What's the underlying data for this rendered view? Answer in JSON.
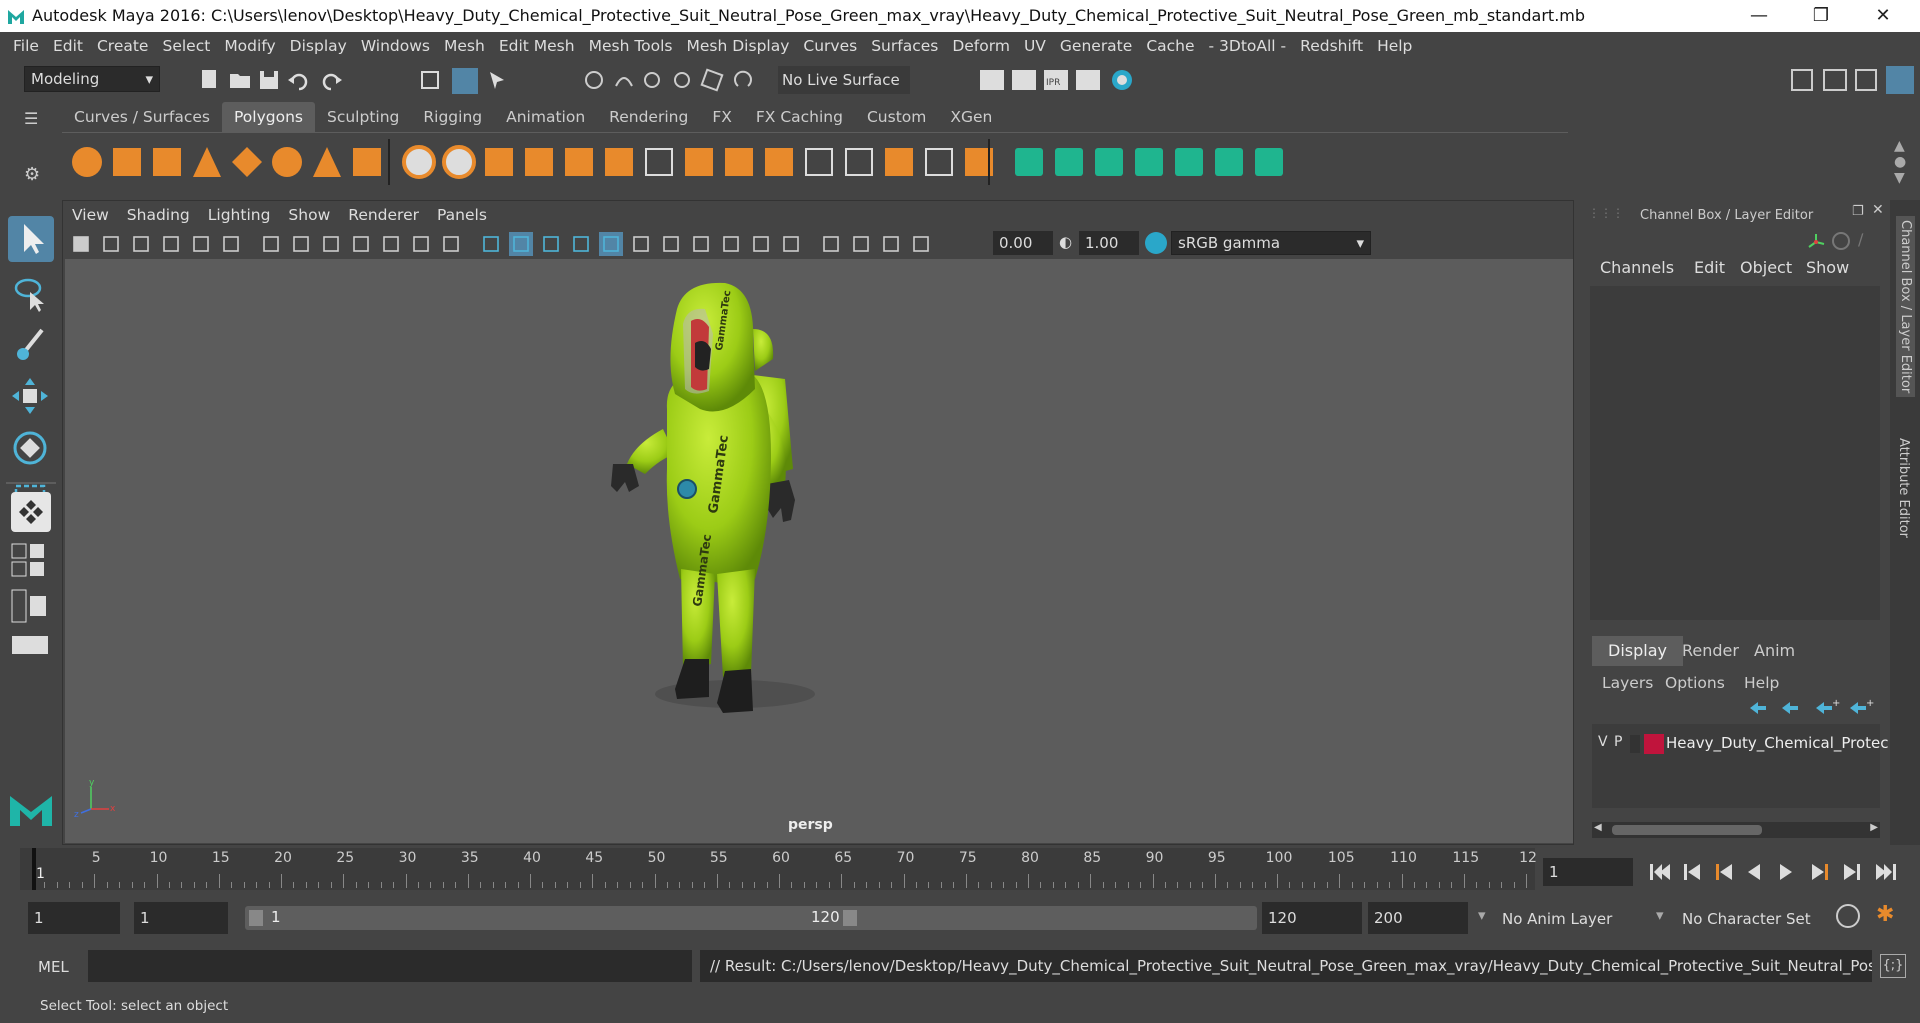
{
  "window": {
    "title": "Autodesk Maya 2016: C:\\Users\\lenov\\Desktop\\Heavy_Duty_Chemical_Protective_Suit_Neutral_Pose_Green_max_vray\\Heavy_Duty_Chemical_Protective_Suit_Neutral_Pose_Green_mb_standart.mb",
    "minimize": "—",
    "restore": "❐",
    "close": "✕"
  },
  "menubar": [
    "File",
    "Edit",
    "Create",
    "Select",
    "Modify",
    "Display",
    "Windows",
    "Mesh",
    "Edit Mesh",
    "Mesh Tools",
    "Mesh Display",
    "Curves",
    "Surfaces",
    "Deform",
    "UV",
    "Generate",
    "Cache",
    "- 3DtoAll -",
    "Redshift",
    "Help"
  ],
  "statusline": {
    "mode": "Modeling",
    "live_surface": "No Live Surface"
  },
  "shelf": {
    "tabs": [
      "Curves / Surfaces",
      "Polygons",
      "Sculpting",
      "Rigging",
      "Animation",
      "Rendering",
      "FX",
      "FX Caching",
      "Custom",
      "XGen"
    ],
    "active_tab": "Polygons"
  },
  "viewport": {
    "menu": [
      "View",
      "Shading",
      "Lighting",
      "Show",
      "Renderer",
      "Panels"
    ],
    "exposure": "0.00",
    "gamma": "1.00",
    "color_space": "sRGB gamma",
    "camera_label": "persp",
    "model_text": "GammaTec"
  },
  "channel_box": {
    "title": "Channel Box / Layer Editor",
    "menu": [
      "Channels",
      "Edit",
      "Object",
      "Show"
    ],
    "layer_tabs": [
      "Display",
      "Render",
      "Anim"
    ],
    "active_layer_tab": "Display",
    "layer_menu": [
      "Layers",
      "Options",
      "Help"
    ],
    "layer": {
      "v": "V",
      "p": "P",
      "name": "Heavy_Duty_Chemical_Protec",
      "color": "#c0143c"
    },
    "side_tabs": [
      "Channel Box / Layer Editor",
      "Attribute Editor"
    ]
  },
  "timeline": {
    "ticks": [
      "5",
      "10",
      "15",
      "20",
      "25",
      "30",
      "35",
      "40",
      "45",
      "50",
      "55",
      "60",
      "65",
      "70",
      "75",
      "80",
      "85",
      "90",
      "95",
      "100",
      "105",
      "110",
      "115",
      "12"
    ],
    "current_frame": "1",
    "current_frame_field": "1"
  },
  "range": {
    "start": "1",
    "playback_start": "1",
    "range_start_label": "1",
    "range_end_label": "120",
    "playback_end": "120",
    "end": "200",
    "anim_layer": "No Anim Layer",
    "character_set": "No Character Set"
  },
  "command": {
    "label": "MEL",
    "result": "// Result: C:/Users/lenov/Desktop/Heavy_Duty_Chemical_Protective_Suit_Neutral_Pose_Green_max_vray/Heavy_Duty_Chemical_Protective_Suit_Neutral_Pose_Green_"
  },
  "help_line": "Select Tool: select an object",
  "colors": {
    "accent": "#5285a6",
    "suit_green": "#9ccc16",
    "orange_icon": "#e88a2c",
    "teal_icon": "#1fb58f"
  }
}
